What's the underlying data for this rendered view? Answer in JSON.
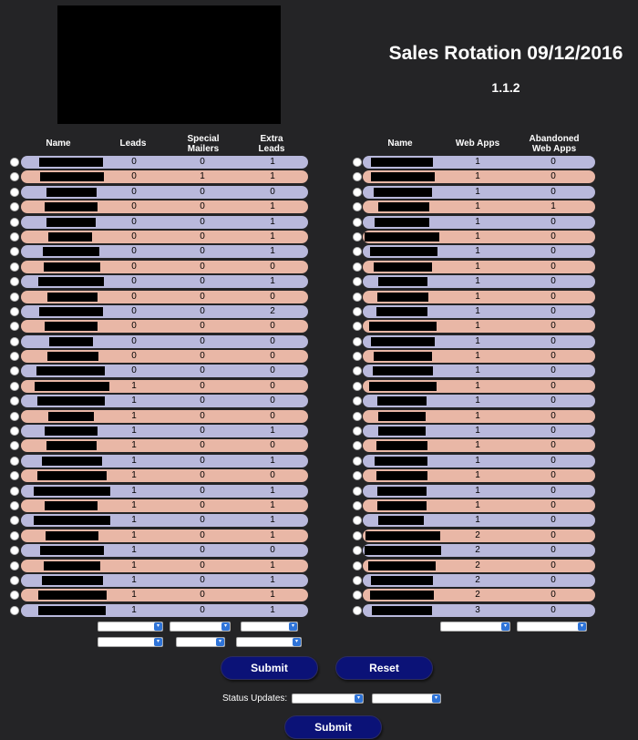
{
  "header": {
    "title": "Sales Rotation 09/12/2016",
    "version": "1.1.2"
  },
  "left_table": {
    "columns": {
      "name": "Name",
      "leads": "Leads",
      "special": "Special Mailers",
      "extra": "Extra Leads"
    },
    "rows": [
      {
        "leads": "0",
        "special": "0",
        "extra": "1"
      },
      {
        "leads": "0",
        "special": "1",
        "extra": "1"
      },
      {
        "leads": "0",
        "special": "0",
        "extra": "0"
      },
      {
        "leads": "0",
        "special": "0",
        "extra": "1"
      },
      {
        "leads": "0",
        "special": "0",
        "extra": "1"
      },
      {
        "leads": "0",
        "special": "0",
        "extra": "1"
      },
      {
        "leads": "0",
        "special": "0",
        "extra": "1"
      },
      {
        "leads": "0",
        "special": "0",
        "extra": "0"
      },
      {
        "leads": "0",
        "special": "0",
        "extra": "1"
      },
      {
        "leads": "0",
        "special": "0",
        "extra": "0"
      },
      {
        "leads": "0",
        "special": "0",
        "extra": "2"
      },
      {
        "leads": "0",
        "special": "0",
        "extra": "0"
      },
      {
        "leads": "0",
        "special": "0",
        "extra": "0"
      },
      {
        "leads": "0",
        "special": "0",
        "extra": "0"
      },
      {
        "leads": "0",
        "special": "0",
        "extra": "0"
      },
      {
        "leads": "1",
        "special": "0",
        "extra": "0"
      },
      {
        "leads": "1",
        "special": "0",
        "extra": "0"
      },
      {
        "leads": "1",
        "special": "0",
        "extra": "0"
      },
      {
        "leads": "1",
        "special": "0",
        "extra": "1"
      },
      {
        "leads": "1",
        "special": "0",
        "extra": "0"
      },
      {
        "leads": "1",
        "special": "0",
        "extra": "1"
      },
      {
        "leads": "1",
        "special": "0",
        "extra": "0"
      },
      {
        "leads": "1",
        "special": "0",
        "extra": "1"
      },
      {
        "leads": "1",
        "special": "0",
        "extra": "1"
      },
      {
        "leads": "1",
        "special": "0",
        "extra": "1"
      },
      {
        "leads": "1",
        "special": "0",
        "extra": "1"
      },
      {
        "leads": "1",
        "special": "0",
        "extra": "0"
      },
      {
        "leads": "1",
        "special": "0",
        "extra": "1"
      },
      {
        "leads": "1",
        "special": "0",
        "extra": "1"
      },
      {
        "leads": "1",
        "special": "0",
        "extra": "1"
      },
      {
        "leads": "1",
        "special": "0",
        "extra": "1"
      }
    ]
  },
  "right_table": {
    "columns": {
      "name": "Name",
      "web_apps": "Web Apps",
      "abandoned": "Abandoned Web Apps"
    },
    "rows": [
      {
        "web": "1",
        "abandoned": "0"
      },
      {
        "web": "1",
        "abandoned": "0"
      },
      {
        "web": "1",
        "abandoned": "0"
      },
      {
        "web": "1",
        "abandoned": "1"
      },
      {
        "web": "1",
        "abandoned": "0"
      },
      {
        "web": "1",
        "abandoned": "0"
      },
      {
        "web": "1",
        "abandoned": "0"
      },
      {
        "web": "1",
        "abandoned": "0"
      },
      {
        "web": "1",
        "abandoned": "0"
      },
      {
        "web": "1",
        "abandoned": "0"
      },
      {
        "web": "1",
        "abandoned": "0"
      },
      {
        "web": "1",
        "abandoned": "0"
      },
      {
        "web": "1",
        "abandoned": "0"
      },
      {
        "web": "1",
        "abandoned": "0"
      },
      {
        "web": "1",
        "abandoned": "0"
      },
      {
        "web": "1",
        "abandoned": "0"
      },
      {
        "web": "1",
        "abandoned": "0"
      },
      {
        "web": "1",
        "abandoned": "0"
      },
      {
        "web": "1",
        "abandoned": "0"
      },
      {
        "web": "1",
        "abandoned": "0"
      },
      {
        "web": "1",
        "abandoned": "0"
      },
      {
        "web": "1",
        "abandoned": "0"
      },
      {
        "web": "1",
        "abandoned": "0"
      },
      {
        "web": "1",
        "abandoned": "0"
      },
      {
        "web": "1",
        "abandoned": "0"
      },
      {
        "web": "2",
        "abandoned": "0"
      },
      {
        "web": "2",
        "abandoned": "0"
      },
      {
        "web": "2",
        "abandoned": "0"
      },
      {
        "web": "2",
        "abandoned": "0"
      },
      {
        "web": "2",
        "abandoned": "0"
      },
      {
        "web": "3",
        "abandoned": "0"
      }
    ]
  },
  "controls": {
    "submit_label": "Submit",
    "reset_label": "Reset",
    "status_label": "Status Updates:",
    "submit2_label": "Submit"
  },
  "colors": {
    "background": "#242426",
    "row_lavender": "#b9b9dc",
    "row_salmon": "#e9b7a6",
    "button": "#0b1277"
  }
}
